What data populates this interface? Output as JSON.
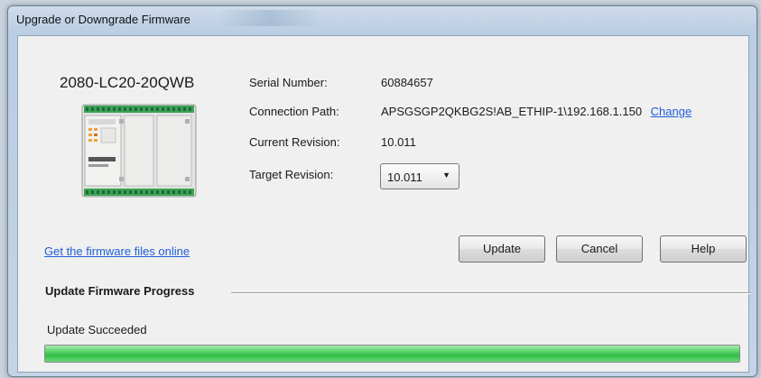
{
  "window": {
    "title": "Upgrade or Downgrade Firmware"
  },
  "device": {
    "model": "2080-LC20-20QWB",
    "image_icon": "plc-controller-icon"
  },
  "info": {
    "serial_label": "Serial Number:",
    "serial_value": "60884657",
    "path_label": "Connection Path:",
    "path_value": "APSGSGP2QKBG2S!AB_ETHIP-1\\192.168.1.150",
    "change_link": "Change",
    "current_label": "Current Revision:",
    "current_value": "10.011",
    "target_label": "Target Revision:",
    "target_selected": "10.011"
  },
  "actions": {
    "online_link": "Get the firmware files online",
    "update_label": "Update",
    "cancel_label": "Cancel",
    "help_label": "Help"
  },
  "progress": {
    "heading": "Update Firmware Progress",
    "status": "Update Succeeded",
    "fraction": 1.0,
    "color": "#2fbf45"
  }
}
